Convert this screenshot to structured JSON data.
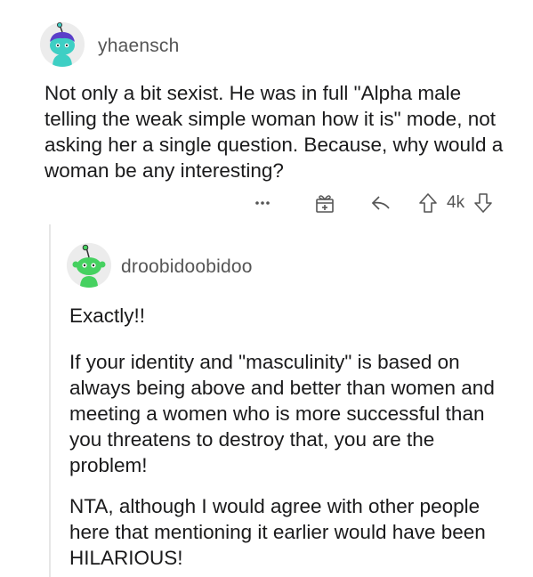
{
  "parent": {
    "username": "yhaensch",
    "body": "Not only a bit sexist. He was in full \"Alpha male telling the weak simple woman how it is\" mode, not asking her a single question. Because, why would a woman be any interesting?",
    "vote_count": "4k",
    "actions": {
      "more_icon": "ellipsis-icon",
      "award_icon": "gift-icon",
      "reply_icon": "reply-arrow-icon",
      "upvote_icon": "upvote-arrow-icon",
      "downvote_icon": "downvote-arrow-icon"
    },
    "avatar_color": "#3ecfc4"
  },
  "reply": {
    "username": "droobidoobidoo",
    "paragraphs": [
      "Exactly!!",
      "If your identity and \"masculinity\" is based on always being above and better than women and meeting a women who is more successful than you threatens to destroy that, you are the problem!",
      "NTA, although I would agree with other people here that mentioning it earlier would have been HILARIOUS!"
    ],
    "avatar_color": "#46d160"
  }
}
